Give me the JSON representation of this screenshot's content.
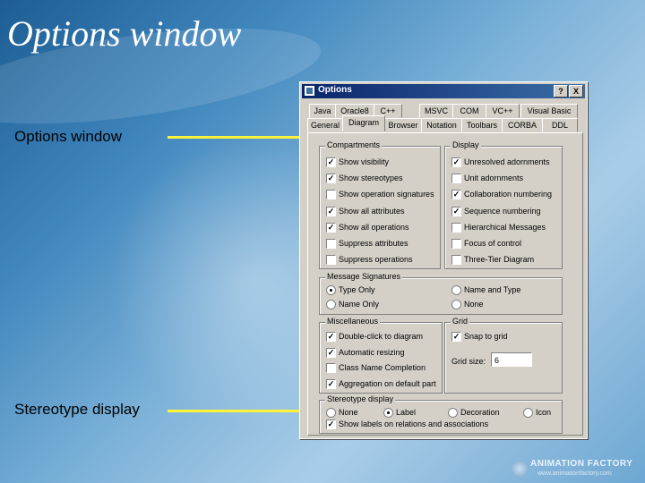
{
  "slide": {
    "title": "Options window",
    "captions": [
      "Options window",
      "Stereotype display"
    ]
  },
  "dialog": {
    "title": "Options",
    "help_label": "?",
    "close_label": "X",
    "tabs_row1": [
      "Java",
      "Oracle8",
      "C++",
      "MSVC",
      "COM",
      "VC++",
      "Visual Basic"
    ],
    "tabs_row2": [
      "General",
      "Diagram",
      "Browser",
      "Notation",
      "Toolbars",
      "CORBA",
      "DDL"
    ],
    "active_tab": "Diagram",
    "compartments": {
      "title": "Compartments",
      "items": [
        {
          "label": "Show visibility",
          "checked": true
        },
        {
          "label": "Show stereotypes",
          "checked": true
        },
        {
          "label": "Show operation signatures",
          "checked": false
        },
        {
          "label": "Show all attributes",
          "checked": true
        },
        {
          "label": "Show all operations",
          "checked": true
        },
        {
          "label": "Suppress attributes",
          "checked": false
        },
        {
          "label": "Suppress operations",
          "checked": false
        }
      ]
    },
    "display": {
      "title": "Display",
      "items": [
        {
          "label": "Unresolved adornments",
          "checked": true
        },
        {
          "label": "Unit adornments",
          "checked": false
        },
        {
          "label": "Collaboration numbering",
          "checked": true
        },
        {
          "label": "Sequence numbering",
          "checked": true
        },
        {
          "label": "Hierarchical Messages",
          "checked": false
        },
        {
          "label": "Focus of control",
          "checked": false
        },
        {
          "label": "Three-Tier Diagram",
          "checked": false
        }
      ]
    },
    "message_signatures": {
      "title": "Message Signatures",
      "options": [
        {
          "label": "Type Only",
          "selected": true
        },
        {
          "label": "Name and Type",
          "selected": false
        },
        {
          "label": "Name Only",
          "selected": false
        },
        {
          "label": "None",
          "selected": false
        }
      ]
    },
    "miscellaneous": {
      "title": "Miscellaneous",
      "items": [
        {
          "label": "Double-click to diagram",
          "checked": true
        },
        {
          "label": "Automatic resizing",
          "checked": true
        },
        {
          "label": "Class Name Completion",
          "checked": false
        },
        {
          "label": "Aggregation on default part",
          "checked": true
        }
      ]
    },
    "grid": {
      "title": "Grid",
      "snap_label": "Snap to grid",
      "snap_checked": true,
      "size_label": "Grid size:",
      "size_value": "6"
    },
    "stereotype_display": {
      "title": "Stereotype display",
      "options": [
        {
          "label": "None",
          "selected": false
        },
        {
          "label": "Label",
          "selected": true
        },
        {
          "label": "Decoration",
          "selected": false
        },
        {
          "label": "Icon",
          "selected": false
        }
      ],
      "show_labels": {
        "label": "Show labels on relations and associations",
        "checked": true
      }
    }
  },
  "branding": {
    "line1": "ANIMATION FACTORY",
    "line2": "www.animationfactory.com"
  },
  "check_mark": "✓"
}
